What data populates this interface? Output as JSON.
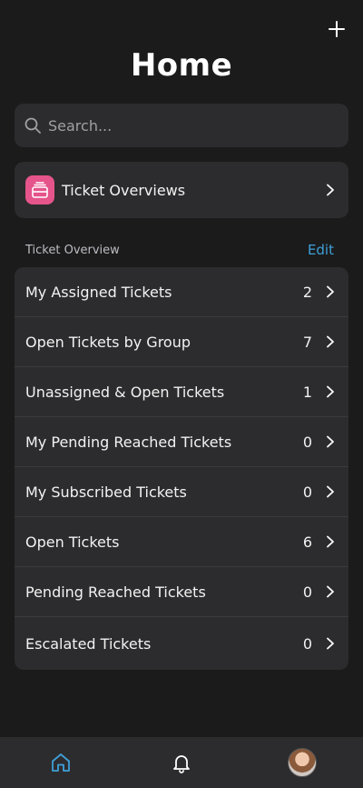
{
  "header": {
    "title": "Home",
    "add_icon": "plus-icon"
  },
  "search": {
    "placeholder": "Search..."
  },
  "overview_link": {
    "label": "Ticket Overviews",
    "icon": "inbox-icon",
    "icon_bg": "#e5548a"
  },
  "section": {
    "caption": "Ticket Overview",
    "edit_label": "Edit"
  },
  "tickets": [
    {
      "name": "My Assigned Tickets",
      "count": "2"
    },
    {
      "name": "Open Tickets by Group",
      "count": "7"
    },
    {
      "name": "Unassigned & Open Tickets",
      "count": "1"
    },
    {
      "name": "My Pending Reached Tickets",
      "count": "0"
    },
    {
      "name": "My Subscribed Tickets",
      "count": "0"
    },
    {
      "name": "Open Tickets",
      "count": "6"
    },
    {
      "name": "Pending Reached Tickets",
      "count": "0"
    },
    {
      "name": "Escalated Tickets",
      "count": "0"
    }
  ],
  "tabbar": {
    "tabs": [
      {
        "id": "home",
        "icon": "home-icon",
        "active": true
      },
      {
        "id": "notifications",
        "icon": "bell-icon",
        "active": false
      },
      {
        "id": "profile",
        "icon": "avatar",
        "active": false
      }
    ],
    "active_color": "#3fa0d8"
  }
}
